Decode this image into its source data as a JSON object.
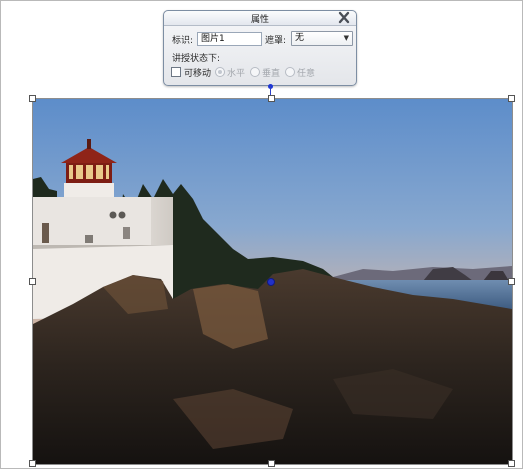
{
  "dialog": {
    "title": "属性",
    "close_icon": "close-icon",
    "id_label": "标识:",
    "id_value": "图片1",
    "mask_label": "遮罩:",
    "mask_value": "无",
    "section_label": "讲授状态下:",
    "movable_label": "可移动",
    "movable_checked": false,
    "radio_horizontal": "水平",
    "radio_vertical": "垂直",
    "radio_any": "任意",
    "radio_selected": "水平"
  },
  "image": {
    "description_icon": "photo-lighthouse-coast"
  },
  "colors": {
    "selection_handle": "#2231c9",
    "connector": "#2b3fc8"
  }
}
